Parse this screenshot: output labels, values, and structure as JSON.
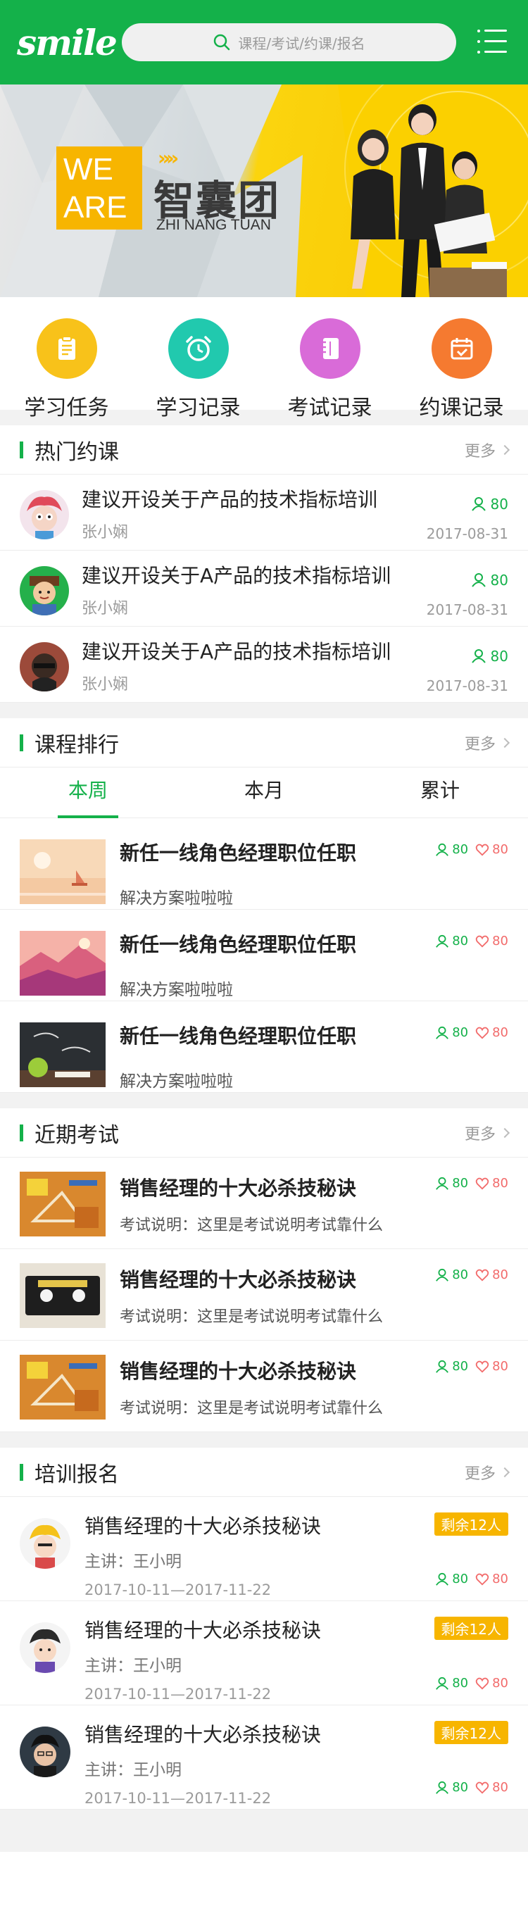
{
  "header": {
    "logo": "smile",
    "search_placeholder": "课程/考试/约课/报名"
  },
  "banner": {
    "we_are": "WE ARE",
    "arrows": "»»",
    "title_cn": "智囊团",
    "title_en": "ZHI NANG TUAN"
  },
  "quick": [
    {
      "label": "学习任务",
      "color": "#f8c21a",
      "icon": "task-list-icon"
    },
    {
      "label": "学习记录",
      "color": "#21c9ae",
      "icon": "alarm-clock-icon"
    },
    {
      "label": "考试记录",
      "color": "#d96bd8",
      "icon": "notebook-icon"
    },
    {
      "label": "约课记录",
      "color": "#f57a30",
      "icon": "calendar-check-icon"
    }
  ],
  "hot": {
    "title": "热门约课",
    "more": "更多",
    "items": [
      {
        "title": "建议开设关于产品的技术指标培训",
        "author": "张小娴",
        "count": "80",
        "date": "2017-08-31"
      },
      {
        "title": "建议开设关于A产品的技术指标培训",
        "author": "张小娴",
        "count": "80",
        "date": "2017-08-31"
      },
      {
        "title": "建议开设关于A产品的技术指标培训",
        "author": "张小娴",
        "count": "80",
        "date": "2017-08-31"
      }
    ]
  },
  "ranking": {
    "title": "课程排行",
    "more": "更多",
    "tabs": [
      "本周",
      "本月",
      "累计"
    ],
    "items": [
      {
        "title": "新任一线角色经理职位任职",
        "sub": "解决方案啦啦啦",
        "views": "80",
        "likes": "80"
      },
      {
        "title": "新任一线角色经理职位任职",
        "sub": "解决方案啦啦啦",
        "views": "80",
        "likes": "80"
      },
      {
        "title": "新任一线角色经理职位任职",
        "sub": "解决方案啦啦啦",
        "views": "80",
        "likes": "80"
      }
    ]
  },
  "exams": {
    "title": "近期考试",
    "more": "更多",
    "items": [
      {
        "title": "销售经理的十大必杀技秘诀",
        "sub": "考试说明：这里是考试说明考试靠什么",
        "views": "80",
        "likes": "80"
      },
      {
        "title": "销售经理的十大必杀技秘诀",
        "sub": "考试说明：这里是考试说明考试靠什么",
        "views": "80",
        "likes": "80"
      },
      {
        "title": "销售经理的十大必杀技秘诀",
        "sub": "考试说明：这里是考试说明考试靠什么",
        "views": "80",
        "likes": "80"
      }
    ]
  },
  "training": {
    "title": "培训报名",
    "more": "更多",
    "items": [
      {
        "title": "销售经理的十大必杀技秘诀",
        "lecturer": "主讲：王小明",
        "dates": "2017-10-11—2017-11-22",
        "badge": "剩余12人",
        "views": "80",
        "likes": "80"
      },
      {
        "title": "销售经理的十大必杀技秘诀",
        "lecturer": "主讲：王小明",
        "dates": "2017-10-11—2017-11-22",
        "badge": "剩余12人",
        "views": "80",
        "likes": "80"
      },
      {
        "title": "销售经理的十大必杀技秘诀",
        "lecturer": "主讲：王小明",
        "dates": "2017-10-11—2017-11-22",
        "badge": "剩余12人",
        "views": "80",
        "likes": "80"
      }
    ]
  },
  "colors": {
    "brand": "#14b14a",
    "badge": "#f7b500",
    "like": "#f26b6b"
  }
}
